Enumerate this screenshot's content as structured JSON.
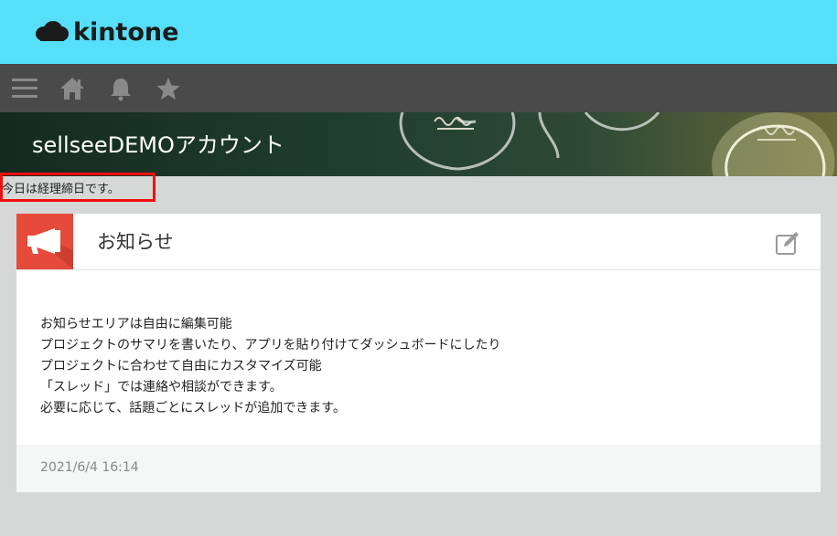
{
  "header": {
    "logo_text": "kintone",
    "brand_color": "#55dff8"
  },
  "nav": {
    "items": [
      {
        "name": "menu",
        "icon": "hamburger-icon"
      },
      {
        "name": "home",
        "icon": "home-icon"
      },
      {
        "name": "notifications",
        "icon": "bell-icon"
      },
      {
        "name": "favorites",
        "icon": "star-icon"
      }
    ]
  },
  "banner": {
    "title": "sellseeDEMOアカウント"
  },
  "daily_notice": "今日は経理締日です。",
  "card": {
    "title": "お知らせ",
    "icon": "megaphone-icon",
    "accent_color": "#e64a3b",
    "edit_icon": "edit-icon",
    "body_lines": [
      "お知らせエリアは自由に編集可能",
      "プロジェクトのサマリを書いたり、アプリを貼り付けてダッシュボードにしたり",
      "プロジェクトに合わせて自由にカスタマイズ可能",
      "「スレッド」では連絡や相談ができます。",
      "必要に応じて、話題ごとにスレッドが追加できます。"
    ],
    "timestamp": "2021/6/4 16:14"
  }
}
